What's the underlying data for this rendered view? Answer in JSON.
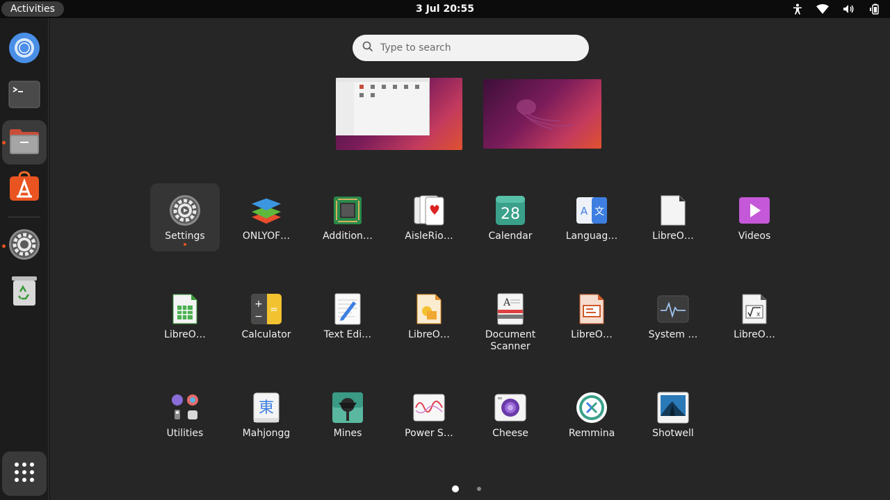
{
  "topbar": {
    "activities_label": "Activities",
    "clock": "3 Jul  20:55",
    "tray_icons": [
      "accessibility-icon",
      "wifi-icon",
      "volume-icon",
      "battery-icon"
    ]
  },
  "dock": {
    "items": [
      {
        "name": "chromium",
        "icon": "chromium-icon",
        "running": false
      },
      {
        "name": "terminal",
        "icon": "terminal-icon",
        "running": false
      },
      {
        "name": "files",
        "icon": "folder-icon",
        "running": true
      },
      {
        "name": "app-center",
        "icon": "app-store-icon",
        "running": false
      },
      {
        "name": "settings",
        "icon": "gear-icon",
        "running": true
      },
      {
        "name": "trash",
        "icon": "trash-icon",
        "running": false
      }
    ],
    "show_apps_icon": "grid-icon"
  },
  "search": {
    "placeholder": "Type to search"
  },
  "apps": [
    {
      "label": "Settings",
      "icon": "gear-icon",
      "running": true,
      "selected": true
    },
    {
      "label": "ONLYOF…",
      "icon": "onlyoffice-icon"
    },
    {
      "label": "Addition…",
      "icon": "chip-icon"
    },
    {
      "label": "AisleRio…",
      "icon": "cards-icon"
    },
    {
      "label": "Calendar",
      "icon": "calendar-icon",
      "calendar_day": "28"
    },
    {
      "label": "Languag…",
      "icon": "language-icon"
    },
    {
      "label": "LibreO…",
      "icon": "libreoffice-doc-icon"
    },
    {
      "label": "Videos",
      "icon": "video-play-icon"
    },
    {
      "label": "LibreO…",
      "icon": "libreoffice-calc-icon"
    },
    {
      "label": "Calculator",
      "icon": "calculator-icon"
    },
    {
      "label": "Text Edi…",
      "icon": "text-editor-icon"
    },
    {
      "label": "LibreO…",
      "icon": "libreoffice-draw-icon"
    },
    {
      "label": "Document Scanner",
      "icon": "scanner-icon"
    },
    {
      "label": "LibreO…",
      "icon": "libreoffice-impress-icon"
    },
    {
      "label": "System …",
      "icon": "system-monitor-icon"
    },
    {
      "label": "LibreO…",
      "icon": "libreoffice-math-icon"
    },
    {
      "label": "Utilities",
      "icon": "folder-grid-icon",
      "folder": true
    },
    {
      "label": "Mahjongg",
      "icon": "mahjongg-icon",
      "tile_char": "東"
    },
    {
      "label": "Mines",
      "icon": "mines-icon"
    },
    {
      "label": "Power S…",
      "icon": "power-statistics-icon"
    },
    {
      "label": "Cheese",
      "icon": "cheese-camera-icon"
    },
    {
      "label": "Remmina",
      "icon": "remmina-icon"
    },
    {
      "label": "Shotwell",
      "icon": "shotwell-icon"
    }
  ],
  "pagination": {
    "pages": 2,
    "current": 1
  },
  "colors": {
    "accent": "#e95420",
    "panel": "#0c0c0c",
    "overview_bg": "#262626"
  }
}
